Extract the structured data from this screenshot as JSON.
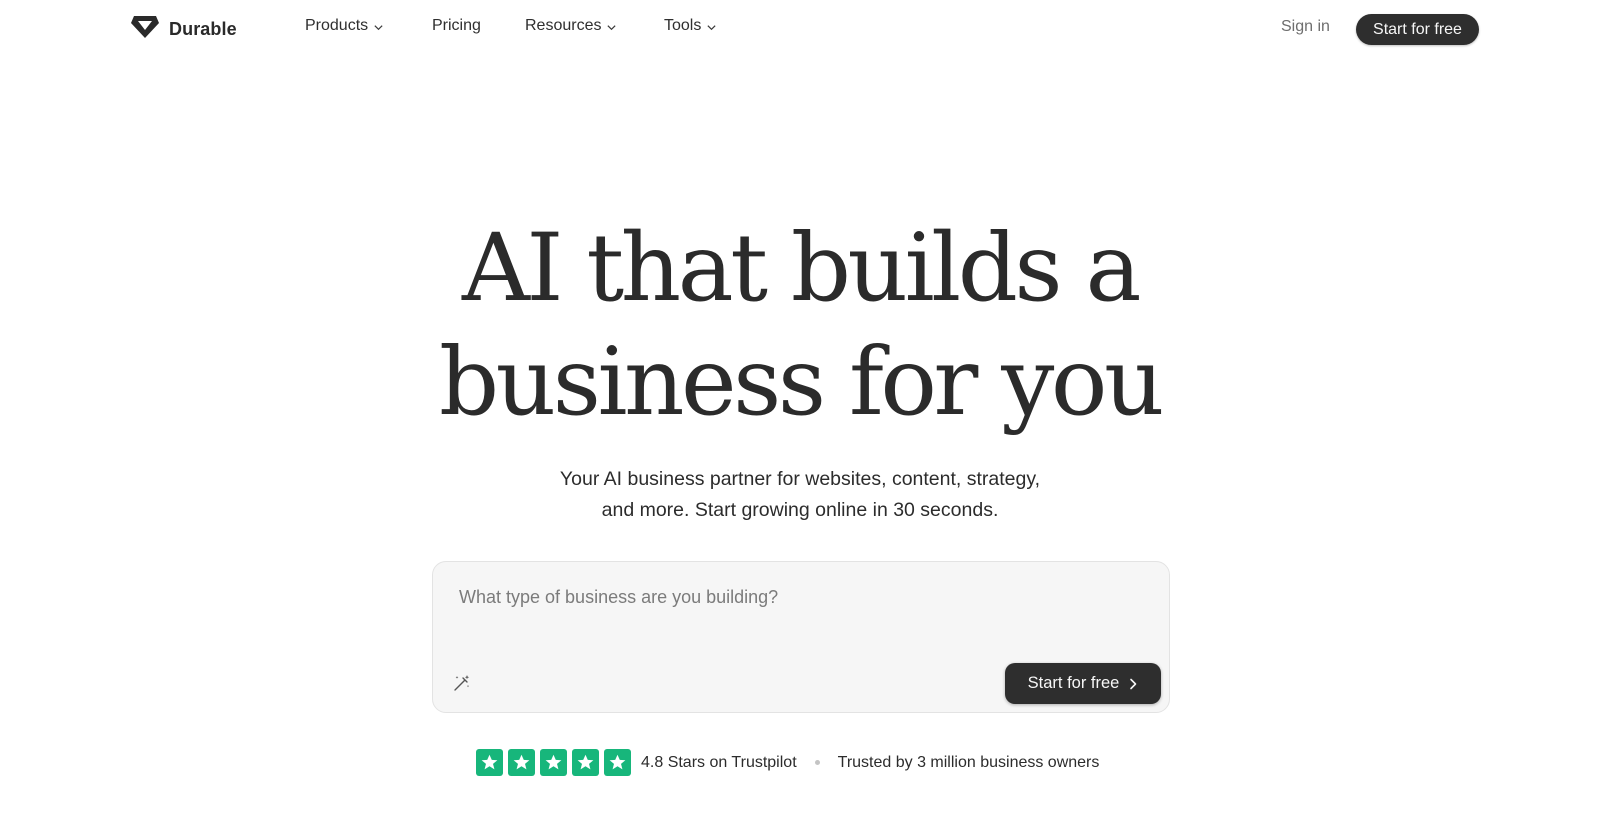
{
  "nav": {
    "brand": "Durable",
    "menu": [
      {
        "label": "Products",
        "dropdown": true
      },
      {
        "label": "Pricing",
        "dropdown": false
      },
      {
        "label": "Resources",
        "dropdown": true
      },
      {
        "label": "Tools",
        "dropdown": true
      }
    ],
    "sign_in": "Sign in",
    "cta": "Start for free"
  },
  "hero": {
    "headline_line1": "AI that builds a",
    "headline_line2": "business for you",
    "subhead_line1": "Your AI business partner for websites, content, strategy,",
    "subhead_line2": "and more. Start growing online in 30 seconds."
  },
  "prompt": {
    "placeholder": "What type of business are you building?",
    "value": "",
    "wand_icon": "magic-wand-icon",
    "cta": "Start for free",
    "cta_icon": "chevron-right-icon"
  },
  "trust": {
    "stars": 5,
    "star_color": "#17b67b",
    "rating_text": "4.8 Stars on Trustpilot",
    "trusted_text": "Trusted by 3 million business owners"
  },
  "colors": {
    "button_dark": "#2e2e2e",
    "text": "#2a2a2a",
    "input_bg": "#f6f6f6"
  }
}
